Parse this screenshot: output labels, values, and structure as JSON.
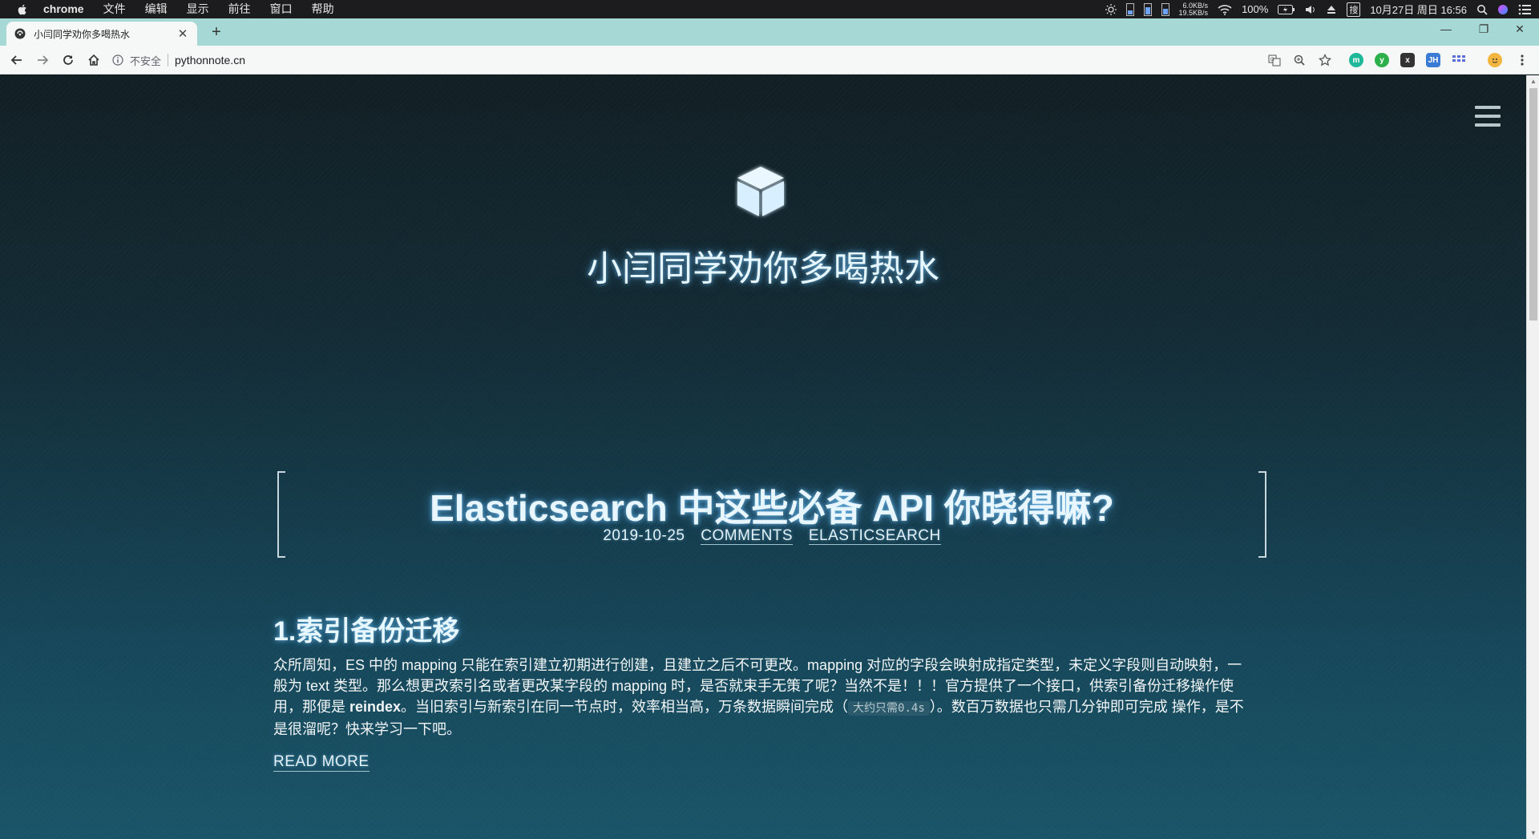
{
  "menubar": {
    "app": "chrome",
    "items": [
      "文件",
      "编辑",
      "显示",
      "前往",
      "窗口",
      "帮助"
    ],
    "net_up": "6.0KB/s",
    "net_down": "19.5KB/s",
    "battery": "100%",
    "ime": "搜",
    "datetime": "10月27日 周日 16:56"
  },
  "browser": {
    "tab_title": "小闫同学劝你多喝热水",
    "insecure_label": "不安全",
    "url": "pythonnote.cn",
    "extension_labels": [
      "m",
      "y",
      "x",
      "JH"
    ]
  },
  "site": {
    "title": "小闫同学劝你多喝热水"
  },
  "post": {
    "title": "Elasticsearch 中这些必备 API 你晓得嘛?",
    "date": "2019-10-25",
    "comments_label": "COMMENTS",
    "category_label": "ELASTICSEARCH",
    "section_heading": "1.索引备份迁移",
    "excerpt_part1": "众所周知，ES 中的 mapping 只能在索引建立初期进行创建，且建立之后不可更改。mapping 对应的字段会映射成指定类型，未定义字段则自动映射，一般为 text 类型。那么想更改索引名或者更改某字段的 mapping 时，是否就束手无策了呢？当然不是！！！官方提供了一个接口，供索引备份迁移操作使用，那便是 ",
    "excerpt_bold": "reindex",
    "excerpt_part2": "。当旧索引与新索引在同一节点时，效率相当高，万条数据瞬间完成（",
    "excerpt_code": "大约只需0.4s",
    "excerpt_part3": "）。数百万数据也只需几分钟即可完成 操作，是不是很溜呢？快来学习一下吧。",
    "read_more_label": "READ MORE"
  },
  "colors": {
    "tab_strip": "#a6d9d5",
    "page_top": "#121f24",
    "page_bottom": "#1a5468",
    "glow": "#78c8ff"
  }
}
